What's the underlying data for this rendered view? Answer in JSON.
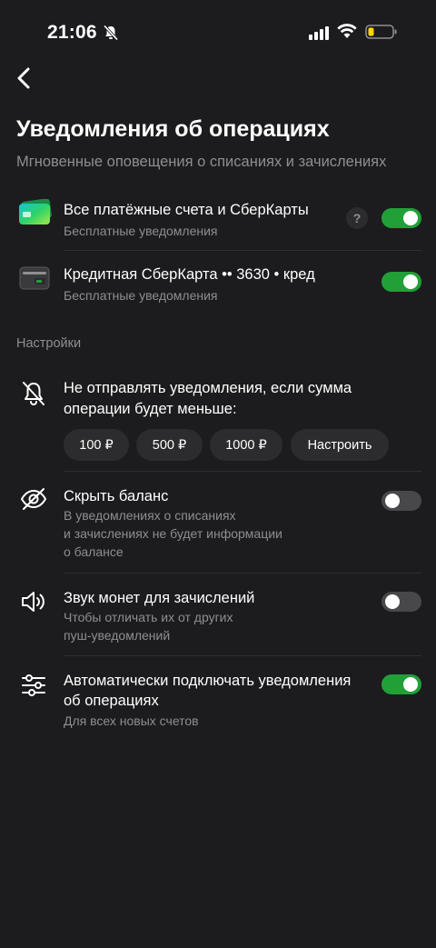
{
  "status_bar": {
    "time": "21:06"
  },
  "header": {
    "title": "Уведомления об операциях",
    "subtitle": "Мгновенные оповещения о списаниях и зачислениях"
  },
  "accounts": [
    {
      "title": "Все платёжные счета и СберКарты",
      "subtitle": "Бесплатные уведомления",
      "icon": "green-card-icon",
      "toggle_on": true,
      "has_help": true
    },
    {
      "title": "Кредитная СберКарта •• 3630 • кред",
      "subtitle": "Бесплатные уведомления",
      "icon": "dark-card-icon",
      "toggle_on": true,
      "has_help": false
    }
  ],
  "help_label": "?",
  "settings": {
    "section_label": "Настройки",
    "min_amount": {
      "title_line1": "Не отправлять уведомления, если сумма",
      "title_line2": "операции будет меньше:",
      "chips": [
        "100 ₽",
        "500 ₽",
        "1000 ₽",
        "Настроить"
      ]
    },
    "hide_balance": {
      "title": "Скрыть баланс",
      "sub_line1": "В уведомлениях о списаниях",
      "sub_line2": "и зачислениях не будет информации",
      "sub_line3": "о балансе",
      "toggle_on": false
    },
    "coin_sound": {
      "title": "Звук монет для зачислений",
      "sub_line1": "Чтобы отличать их от других",
      "sub_line2": "пуш-уведомлений",
      "toggle_on": false
    },
    "auto_connect": {
      "title_line1": "Автоматически подключать уведомления",
      "title_line2": "об операциях",
      "sub": "Для всех новых счетов",
      "toggle_on": true
    }
  },
  "colors": {
    "background": "#1c1c1e",
    "accent": "#21a038",
    "secondary_text": "#8e8e93"
  }
}
